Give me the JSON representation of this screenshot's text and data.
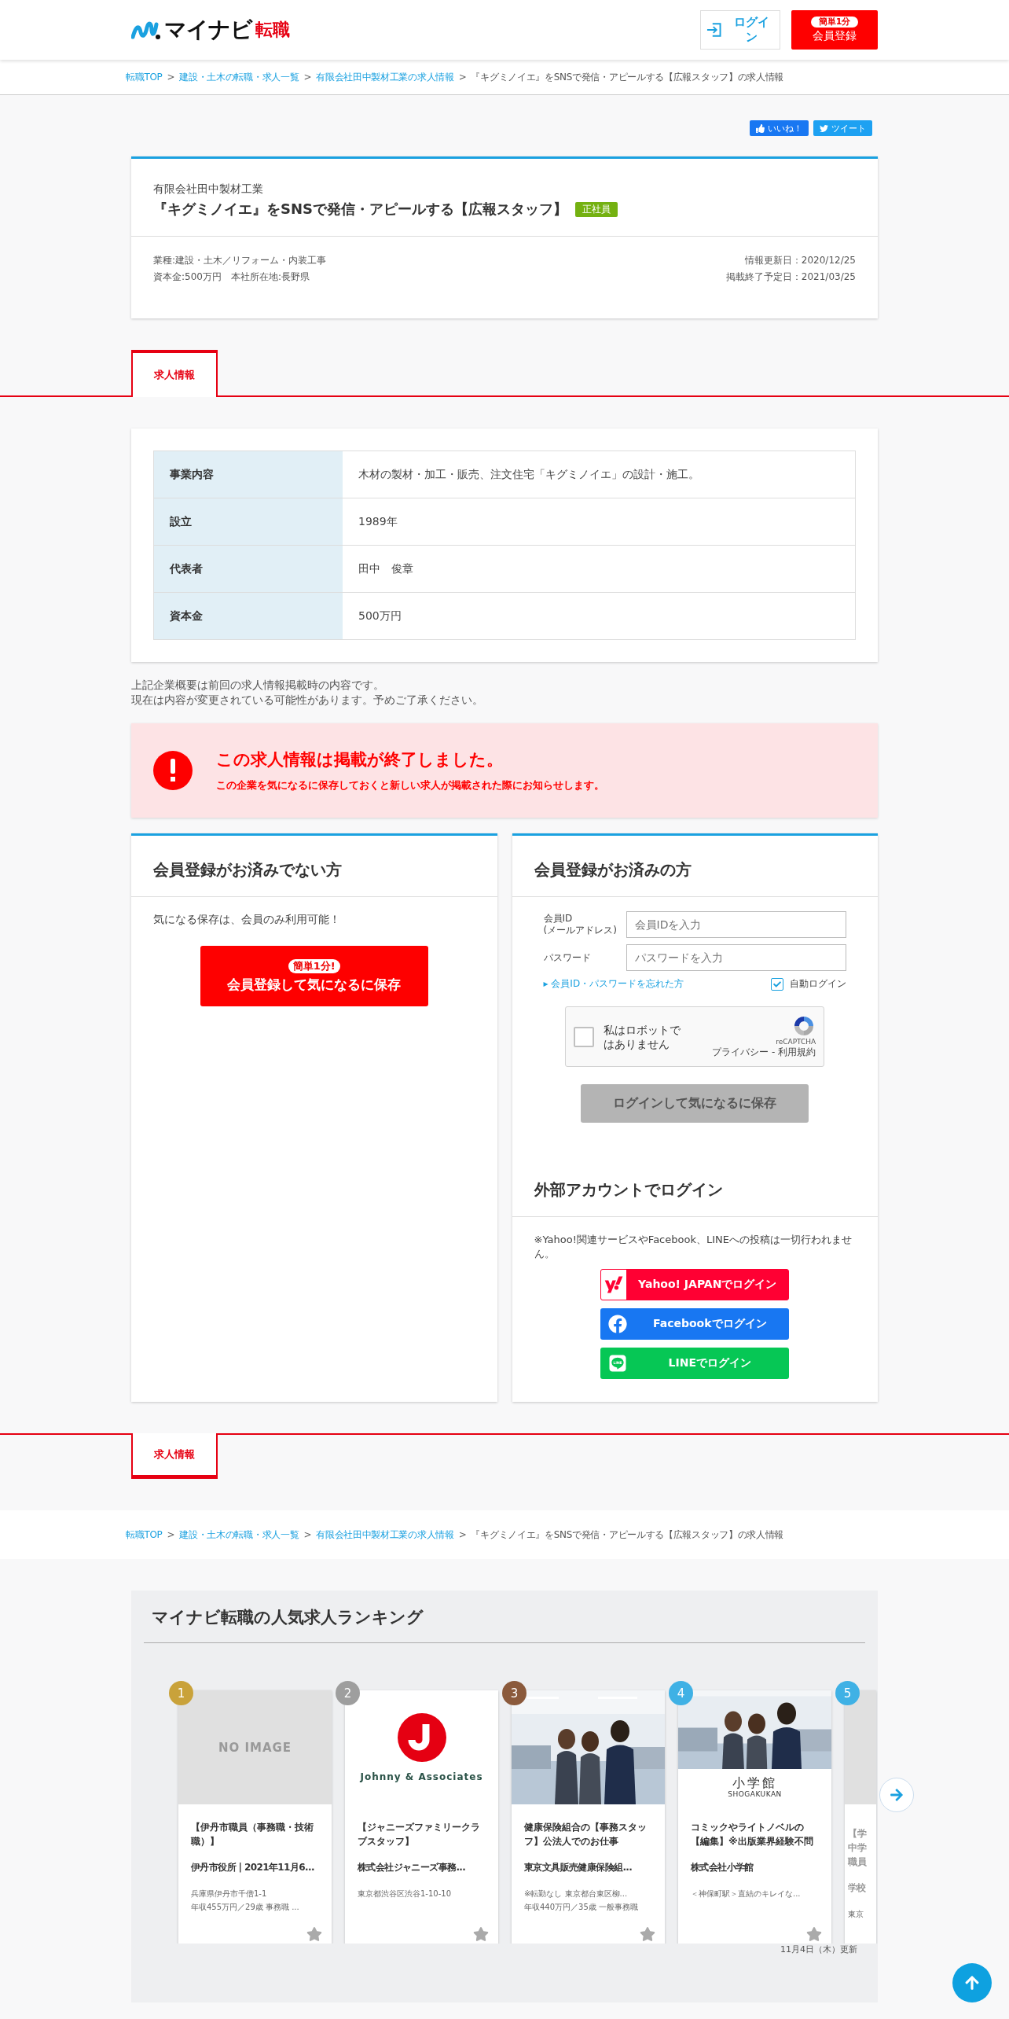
{
  "header": {
    "logo_text": "マイナビ",
    "logo_sub": "転職",
    "login": "ログイン",
    "register_badge": "簡単1分",
    "register": "会員登録"
  },
  "breadcrumb": {
    "separator": ">",
    "items": [
      {
        "label": "転職TOP",
        "link": true
      },
      {
        "label": "建設・土木の転職・求人一覧",
        "link": true
      },
      {
        "label": "有限会社田中製材工業の求人情報",
        "link": true
      },
      {
        "label": "『キグミノイエ』をSNSで発信・アピールする【広報スタッフ】の求人情報",
        "link": false
      }
    ]
  },
  "social": [
    {
      "kind": "like",
      "label": "いいね！"
    },
    {
      "kind": "tweet",
      "label": "ツイート"
    }
  ],
  "job": {
    "company": "有限会社田中製材工業",
    "title": "『キグミノイエ』をSNSで発信・アピールする【広報スタッフ】",
    "tag": "正社員",
    "meta": [
      "業種:建設・土木／リフォーム・内装工事",
      "資本金:500万円　本社所在地:長野県"
    ],
    "dates": [
      "情報更新日：2020/12/25",
      "掲載終了予定日：2021/03/25"
    ]
  },
  "tabs": {
    "kind": "raised",
    "items": [
      {
        "label": "求人情報",
        "selected": true
      }
    ]
  },
  "company_table": [
    {
      "label": "事業内容",
      "value": "木材の製材・加工・販売、注文住宅「キグミノイエ」の設計・施工。"
    },
    {
      "label": "設立",
      "value": "1989年"
    },
    {
      "label": "代表者",
      "value": "田中　俊章"
    },
    {
      "label": "資本金",
      "value": "500万円"
    }
  ],
  "note": [
    "上記企業概要は前回の求人情報掲載時の内容です。",
    "現在は内容が変更されている可能性があります。予めご了承ください。"
  ],
  "alert": {
    "title": "この求人情報は掲載が終了しました。",
    "message": "この企業を気になるに保存しておくと新しい求人が掲載された際にお知らせします。"
  },
  "guest_panel": {
    "title": "会員登録がお済みでない方",
    "text": "気になる保存は、会員のみ利用可能！",
    "button_badge": "簡単1分!",
    "button": "会員登録して気になるに保存"
  },
  "member_panel": {
    "title": "会員登録がお済みの方",
    "fields": [
      {
        "label": "会員ID",
        "sublabel": "(メールアドレス)",
        "placeholder": "会員IDを入力"
      },
      {
        "label": "パスワード",
        "placeholder": "パスワードを入力"
      }
    ],
    "forgot_bullet": "▸",
    "forgot_link": "会員ID・パスワードを忘れた方",
    "auto_login": {
      "label": "自動ログイン",
      "checked": true
    },
    "captcha": {
      "label": "私はロボットではありません",
      "brand": "reCAPTCHA",
      "links": "プライバシー - 利用規約",
      "checked": false
    },
    "submit": {
      "label": "ログインして気になるに保存",
      "disabled": true
    },
    "external_title": "外部アカウントでログイン",
    "external_note": "※Yahoo!関連サービスやFacebook、LINEへの投稿は一切行われません。",
    "providers": [
      {
        "kind": "yahoo",
        "label": "Yahoo! JAPANでログイン"
      },
      {
        "kind": "facebook",
        "label": "Facebookでログイン"
      },
      {
        "kind": "line",
        "label": "LINEでログイン"
      }
    ]
  },
  "tabs_bottom": {
    "kind": "hanging",
    "items": [
      {
        "label": "求人情報",
        "selected": true
      }
    ]
  },
  "breadcrumb_bottom": {
    "separator": ">",
    "items": [
      {
        "label": "転職TOP",
        "link": true
      },
      {
        "label": "建設・土木の転職・求人一覧",
        "link": true
      },
      {
        "label": "有限会社田中製材工業の求人情報",
        "link": true
      },
      {
        "label": "『キグミノイエ』をSNSで発信・アピールする【広報スタッフ】の求人情報",
        "link": false
      }
    ]
  },
  "ranking": {
    "title": "マイナビ転職の人気求人ランキング",
    "updated": "11月4日（木）更新",
    "cards": [
      {
        "rank": "1",
        "color": "#c9a23a",
        "image": {
          "kind": "noimage",
          "text": "NO IMAGE"
        },
        "title": "【伊丹市職員（事務職・技術職）】",
        "company": "伊丹市役所 | 2021年11月6...",
        "details": [
          "兵庫県伊丹市千僧1-1",
          "年収455万円／29歳 事務職 ..."
        ]
      },
      {
        "rank": "2",
        "color": "#9e9e9e",
        "image": {
          "kind": "logo",
          "text": "Johnny & Associates"
        },
        "title": "【ジャニーズファミリークラブスタッフ】",
        "company": "株式会社ジャニーズ事務...",
        "details": [
          "東京都渋谷区渋谷1-10-10"
        ]
      },
      {
        "rank": "3",
        "color": "#8b5a3c",
        "image": {
          "kind": "picture"
        },
        "title": "健康保険組合の【事務スタッフ】公法人でのお仕事",
        "company": "東京文具販売健康保険組...",
        "details": [
          "※転勤なし 東京都台東区柳...",
          "年収440万円／35歳 一般事務職"
        ]
      },
      {
        "rank": "4",
        "color": "#3fb1e5",
        "image": {
          "kind": "picture_logo",
          "text": "小学館",
          "subtext": "SHOGAKUKAN"
        },
        "title": "コミックやライトノベルの【編集】※出版業界経験不問",
        "company": "株式会社小学館",
        "details": [
          "＜神保町駅＞直結のキレイな..."
        ]
      },
      {
        "rank": "5",
        "color": "#3fb1e5",
        "partial": true,
        "title_lines": [
          "【学",
          "中学",
          "職員"
        ],
        "company": "学校",
        "details": [
          "東京"
        ]
      }
    ]
  }
}
